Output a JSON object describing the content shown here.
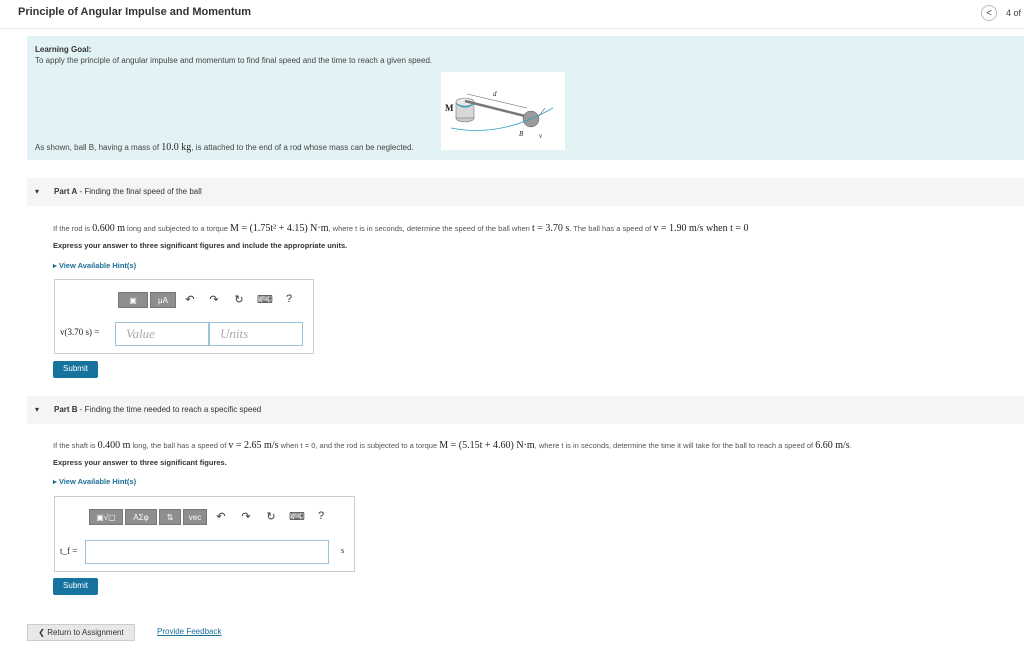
{
  "header": {
    "title": "Principle of Angular Impulse and Momentum",
    "pager_back": "<",
    "pager_text": "4 of"
  },
  "goal": {
    "heading": "Learning Goal:",
    "text": "To apply the principle of angular impulse and momentum to find final speed and the time to reach a given speed.",
    "desc_pre": "As shown, ball B, having a mass of ",
    "mass": "10.0 kg",
    "desc_post": ", is attached to the end of a rod whose mass can be neglected.",
    "figure_labels": {
      "m": "M",
      "d": "d",
      "b": "B",
      "v": "v"
    }
  },
  "partA": {
    "toggle": "▾",
    "label": "Part A",
    "title": " - Finding the final speed of the ball",
    "question_pre": "If the rod is ",
    "length": "0.600 m",
    "question_mid": " long and subjected to a torque ",
    "torque": "M = (1.75t² + 4.15) N·m",
    "question_mid2": ", where t is in seconds, determine the speed of the ball when ",
    "time": "t = 3.70 s",
    "question_mid3": ". The ball has a speed of ",
    "speed": "v = 1.90 m/s",
    "question_end": " when t = 0",
    "instruction": "Express your answer to three significant figures and include the appropriate units.",
    "hint": "▸  View Available Hint(s)",
    "toolbar": {
      "templates": "▣",
      "units": "μA",
      "undo": "↶",
      "redo": "↷",
      "reset": "↻",
      "keyboard": "⌨",
      "help": "?"
    },
    "answer_label": "v(3.70 s) =",
    "value_placeholder": "Value",
    "units_placeholder": "Units",
    "submit": "Submit"
  },
  "partB": {
    "toggle": "▾",
    "label": "Part B",
    "title": " - Finding the time needed to reach a specific speed",
    "question_pre": "If the shaft is ",
    "length": "0.400 m",
    "question_mid": " long, the ball has a speed of ",
    "speed": "v = 2.65 m/s",
    "question_mid2": " when t = 0, and the rod is subjected to a torque ",
    "torque": "M = (5.15t + 4.60) N·m",
    "question_mid3": ", where t is in seconds, determine the time it will take for the ball to reach a speed of ",
    "target_speed": "6.60 m/s",
    "question_end": ".",
    "instruction": "Express your answer to three significant figures.",
    "hint": "▸  View Available Hint(s)",
    "toolbar": {
      "templates": "▣√▢",
      "greek": "AΣφ",
      "arrows": "⇅",
      "vec": "vec",
      "undo": "↶",
      "redo": "↷",
      "reset": "↻",
      "keyboard": "⌨",
      "help": "?"
    },
    "answer_label": "t_f =",
    "unit": "s",
    "submit": "Submit"
  },
  "footer": {
    "return": "❮ Return to Assignment",
    "feedback": "Provide Feedback"
  }
}
